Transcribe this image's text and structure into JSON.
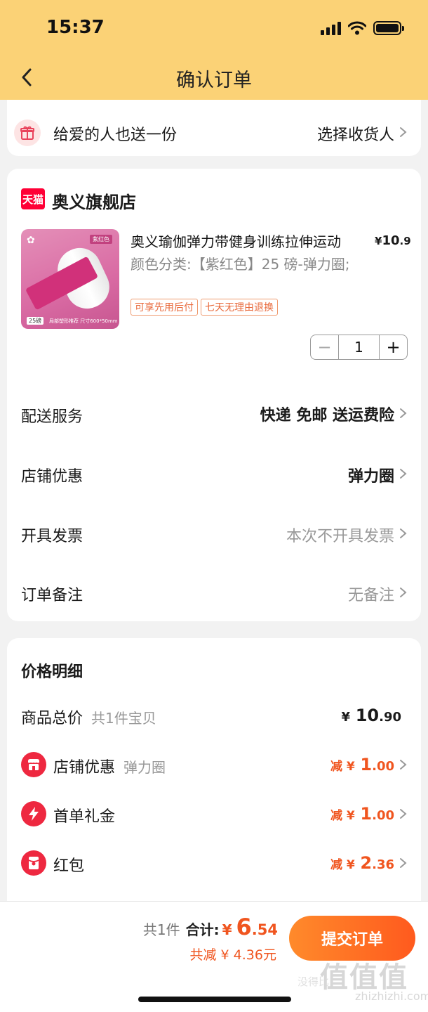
{
  "status_bar": {
    "time": "15:37"
  },
  "nav": {
    "title": "确认订单"
  },
  "gift": {
    "label": "给爱的人也送一份",
    "action": "选择收货人"
  },
  "shop": {
    "logo_text": "天猫",
    "name": "奥义旗舰店"
  },
  "product": {
    "title": "奥义瑜伽弹力带健身训练拉伸运动",
    "price_symbol": "¥",
    "price_int": "10",
    "price_dec": ".9",
    "spec": "颜色分类:【紫红色】25 磅-弹力圈;",
    "tags": [
      "可享先用后付",
      "七天无理由退换"
    ],
    "image": {
      "color_tag": "紫红色",
      "weight": "25磅",
      "caption": "局部塑形推荐  尺寸600*50mm"
    },
    "quantity": "1",
    "minus": "−",
    "plus": "+"
  },
  "options": [
    {
      "label": "配送服务",
      "value": "快递 免邮 送运费险"
    },
    {
      "label": "店铺优惠",
      "value": "弹力圈"
    },
    {
      "label": "开具发票",
      "value": "本次不开具发票"
    },
    {
      "label": "订单备注",
      "value": "无备注"
    }
  ],
  "price_detail": {
    "title": "价格明细",
    "goods_total": {
      "label": "商品总价",
      "sub": "共1件宝贝",
      "symbol": "¥",
      "int": "10",
      "dec": ".90"
    },
    "items": [
      {
        "label": "店铺优惠",
        "sub": "弹力圈",
        "prefix": "减 ¥",
        "int": "1",
        "dec": ".00",
        "icon": "shop-coupon-icon"
      },
      {
        "label": "首单礼金",
        "sub": "",
        "prefix": "减 ¥",
        "int": "1",
        "dec": ".00",
        "icon": "lightning-icon"
      },
      {
        "label": "红包",
        "sub": "",
        "prefix": "减 ¥",
        "int": "2",
        "dec": ".36",
        "icon": "red-packet-icon"
      }
    ]
  },
  "bottom": {
    "count": "共1件",
    "total_label": "合计:",
    "symbol": "¥",
    "total_int": "6",
    "total_dec": ".54",
    "saved": "共减 ¥ 4.36元",
    "submit": "提交订单"
  },
  "watermark": {
    "big": "值值值",
    "small": "zhizhizhi.com",
    "left": "没得比"
  },
  "colors": {
    "header": "#fbd276",
    "accent": "#f0551f",
    "tmall": "#ff0036"
  }
}
